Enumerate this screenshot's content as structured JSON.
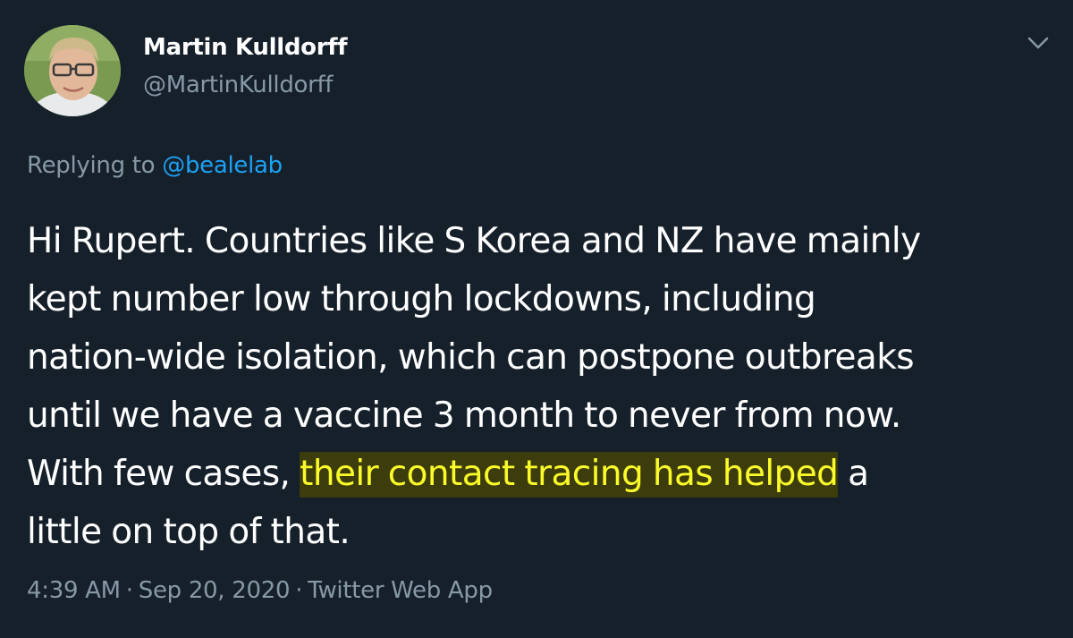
{
  "author": {
    "name": "Martin Kulldorff",
    "handle": "@MartinKulldorff",
    "avatar_icon": "profile-photo"
  },
  "menu": {
    "caret_icon": "chevron-down-icon"
  },
  "reply": {
    "prefix": "Replying to",
    "mention": "@bealelab"
  },
  "body": {
    "line1": "Hi Rupert. Countries like S Korea and NZ have mainly",
    "line2": "kept number low through lockdowns, including",
    "line3": "nation-wide isolation, which can postpone outbreaks",
    "line4": "until we have a vaccine 3 month to never from now.",
    "line5_start": "With few cases, ",
    "line5_highlight": "their contact tracing has helped",
    "line5_end": " a",
    "line6": "little on top of that."
  },
  "meta": {
    "time": "4:39 AM",
    "separator": "·",
    "date": "Sep 20, 2020",
    "app": "Twitter Web App"
  },
  "colors": {
    "background": "#15202b",
    "secondary_text": "#8899a6",
    "link": "#1da1f2",
    "highlight_text": "#fbfb2a"
  }
}
